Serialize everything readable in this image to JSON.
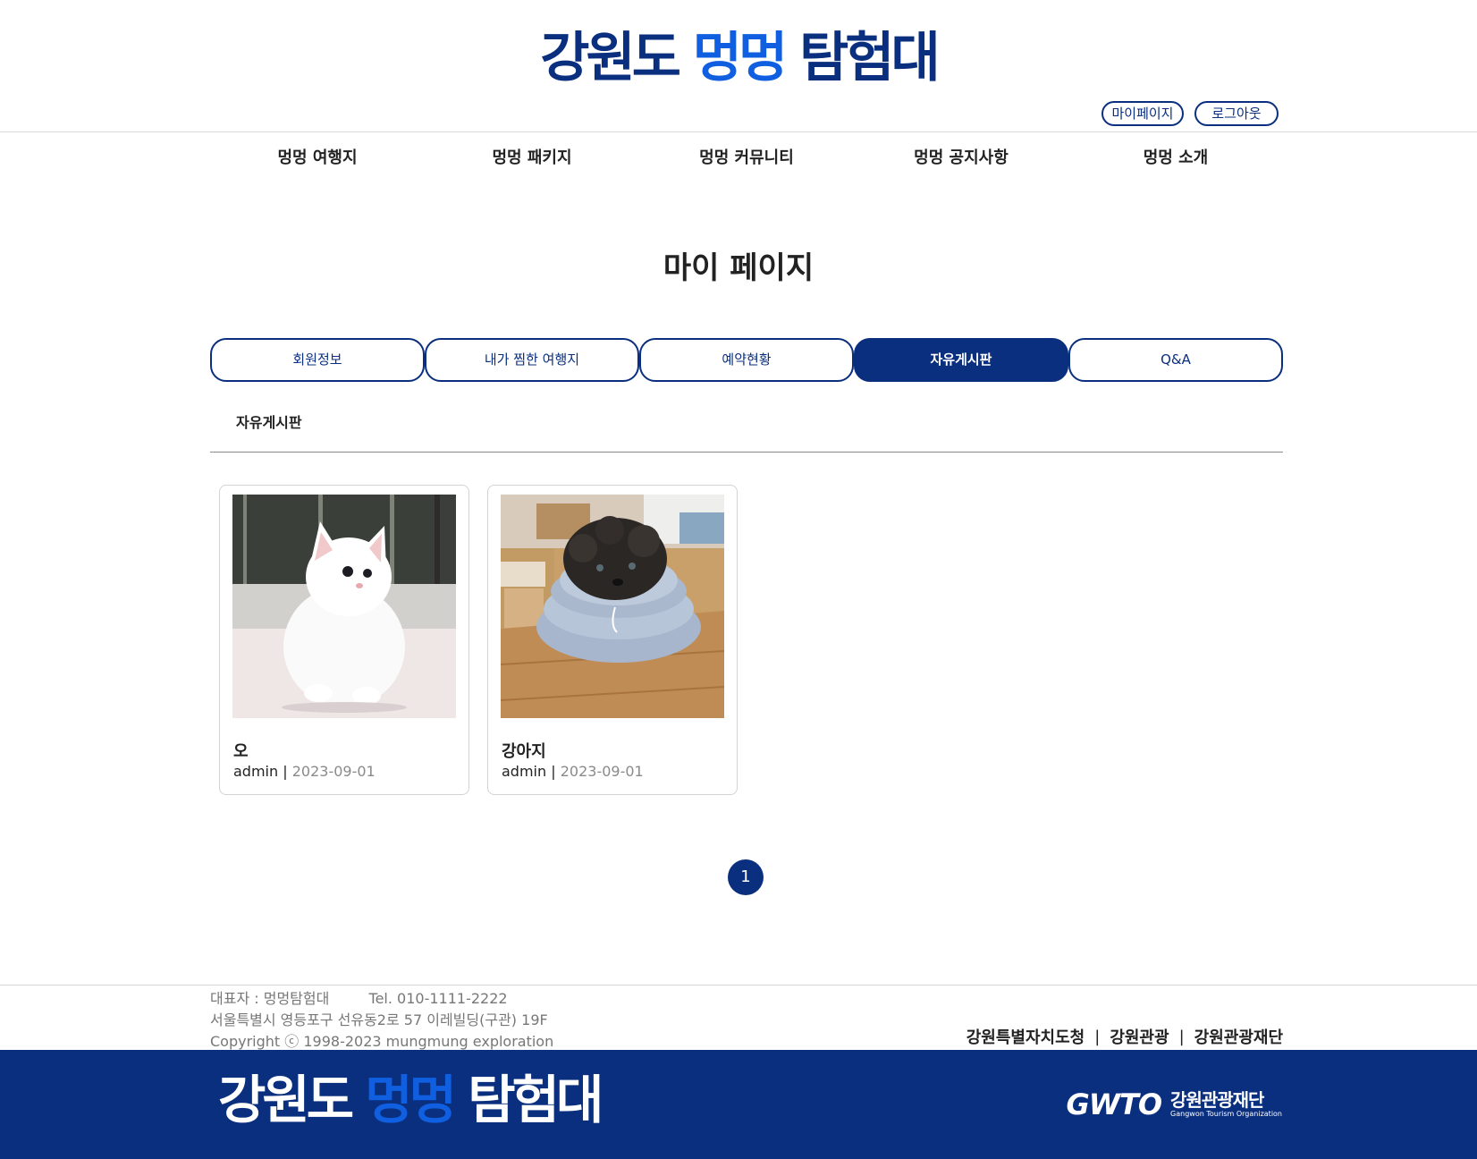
{
  "header": {
    "logo": {
      "part1": "강원도",
      "part2": "멍멍",
      "part3": "탐험대"
    },
    "mypage_label": "마이페이지",
    "logout_label": "로그아웃"
  },
  "nav": {
    "items": [
      "멍멍 여행지",
      "멍멍 패키지",
      "멍멍 커뮤니티",
      "멍멍 공지사항",
      "멍멍 소개"
    ]
  },
  "main": {
    "page_title": "마이 페이지",
    "tabs": [
      {
        "label": "회원정보",
        "active": false
      },
      {
        "label": "내가 찜한 여행지",
        "active": false
      },
      {
        "label": "예약현황",
        "active": false
      },
      {
        "label": "자유게시판",
        "active": true
      },
      {
        "label": "Q&A",
        "active": false
      }
    ],
    "section_label": "자유게시판",
    "posts": [
      {
        "title": "오",
        "author": "admin",
        "separator": "|",
        "date": "2023-09-01",
        "image": "white-kitten-photo"
      },
      {
        "title": "강아지",
        "author": "admin",
        "separator": "|",
        "date": "2023-09-01",
        "image": "dog-with-cone-collar-photo"
      }
    ],
    "pagination": {
      "current": "1"
    }
  },
  "footer": {
    "rep": "대표자 : 멍멍탐험대",
    "tel": "Tel. 010-1111-2222",
    "address": "서울특별시 영등포구 선유동2로 57 이레빌딩(구관) 19F",
    "copyright": "Copyright ⓒ 1998-2023 mungmung exploration",
    "links": [
      "강원특별자치도청",
      "강원관광",
      "강원관광재단"
    ],
    "link_separator": "|",
    "org_mark": "GWTO",
    "org_name_kr": "강원관광재단",
    "org_name_en": "Gangwon Tourism Organization"
  },
  "colors": {
    "navy": "#0a2f7f",
    "brand_blue": "#0f5fe0",
    "border": "#d3d3d3",
    "muted": "#8a8a8a"
  }
}
